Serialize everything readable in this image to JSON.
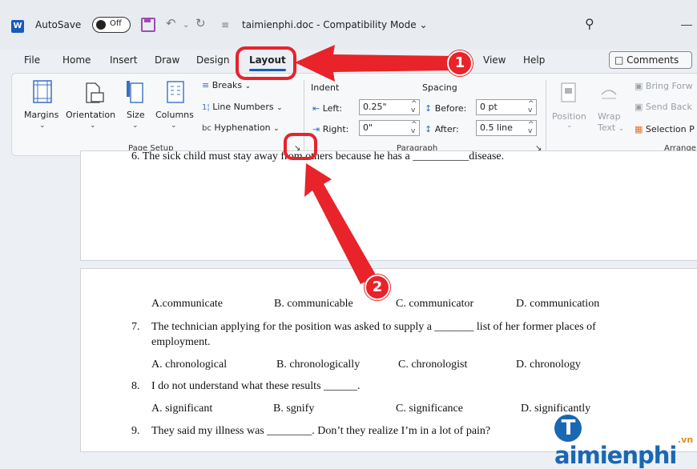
{
  "titlebar": {
    "autosave_label": "AutoSave",
    "autosave_state": "Off",
    "document_title": "taimienphi.doc - Compatibility Mode",
    "title_chevron": "⌄"
  },
  "tabs": [
    {
      "label": "File"
    },
    {
      "label": "Home"
    },
    {
      "label": "Insert"
    },
    {
      "label": "Draw"
    },
    {
      "label": "Design"
    },
    {
      "label": "Layout"
    },
    {
      "label": "View"
    },
    {
      "label": "Help"
    }
  ],
  "comments_label": "Comments",
  "ribbon": {
    "page_setup": {
      "margins": "Margins",
      "orientation": "Orientation",
      "size": "Size",
      "columns": "Columns",
      "breaks": "Breaks",
      "line_numbers": "Line Numbers",
      "hyphenation": "Hyphenation",
      "group_label": "Page Setup"
    },
    "paragraph": {
      "indent_header": "Indent",
      "spacing_header": "Spacing",
      "left_label": "Left:",
      "left_value": "0.25\"",
      "right_label": "Right:",
      "right_value": "0\"",
      "before_label": "Before:",
      "before_value": "0 pt",
      "after_label": "After:",
      "after_value": "0.5 line",
      "group_label": "Paragraph"
    },
    "arrange": {
      "position": "Position",
      "wrap": "Wrap",
      "text": "Text",
      "bring_forward": "Bring Forw",
      "send_backward": "Send Back",
      "selection_pane": "Selection P",
      "group_label": "Arrange"
    }
  },
  "document": {
    "line6": "6.   The sick child must stay away from others because he has a __________disease.",
    "opts6": [
      "A.communicate",
      "B. communicable",
      "C. communicator",
      "D. communication"
    ],
    "q7_num": "7.",
    "q7_line1": "The technician applying for the position was asked to supply a _______ list of her former places of",
    "q7_line2": "employment.",
    "opts7": [
      "A. chronological",
      "B. chronologically",
      "C. chronologist",
      "D. chronology"
    ],
    "q8_num": "8.",
    "q8": "I do not understand what these results ______.",
    "opts8": [
      "A. significant",
      "B. sgnify",
      "C. significance",
      "D. significantly"
    ],
    "q9_num": "9.",
    "q9": "They said my illness was ________. Don’t they realize I’m in a lot of pain?"
  },
  "annotations": {
    "badge1": "1",
    "badge2": "2"
  },
  "watermark": {
    "t": "T",
    "rest": "aimienphi",
    "suffix": ".vn"
  },
  "colors": {
    "accent": "#185abd",
    "annotation_red": "#e8232a",
    "logo_blue": "#1a67b3",
    "logo_orange": "#f08a1c"
  }
}
